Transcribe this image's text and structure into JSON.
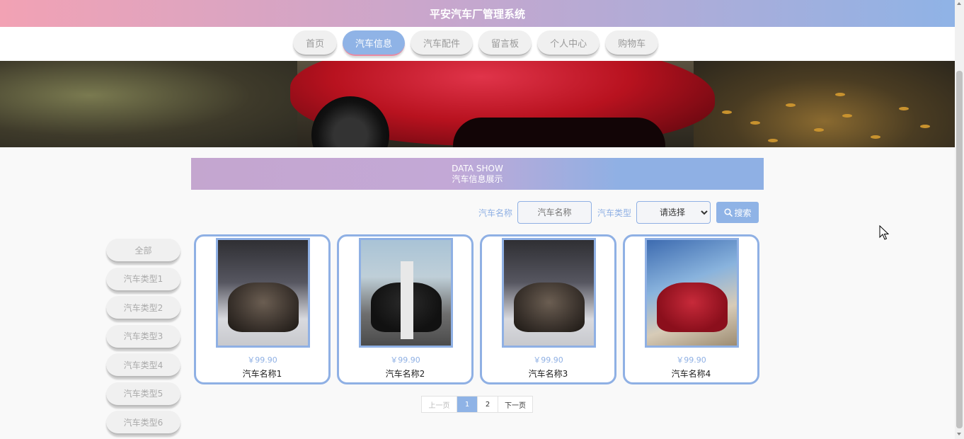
{
  "header": {
    "title": "平安汽车厂管理系统"
  },
  "nav": {
    "items": [
      {
        "label": "首页",
        "active": false
      },
      {
        "label": "汽车信息",
        "active": true
      },
      {
        "label": "汽车配件",
        "active": false
      },
      {
        "label": "留言板",
        "active": false
      },
      {
        "label": "个人中心",
        "active": false
      },
      {
        "label": "购物车",
        "active": false
      }
    ]
  },
  "section": {
    "title_en": "DATA SHOW",
    "title_cn": "汽车信息展示"
  },
  "search": {
    "name_label": "汽车名称",
    "name_placeholder": "汽车名称",
    "type_label": "汽车类型",
    "type_selected": "请选择",
    "button_label": "搜索"
  },
  "sidebar": {
    "items": [
      "全部",
      "汽车类型1",
      "汽车类型2",
      "汽车类型3",
      "汽车类型4",
      "汽车类型5",
      "汽车类型6"
    ]
  },
  "products": [
    {
      "price": "￥99.90",
      "name": "汽车名称1"
    },
    {
      "price": "￥99.90",
      "name": "汽车名称2"
    },
    {
      "price": "￥99.90",
      "name": "汽车名称3"
    },
    {
      "price": "￥99.90",
      "name": "汽车名称4"
    }
  ],
  "pagination": {
    "prev_label": "上一页",
    "pages": [
      "1",
      "2"
    ],
    "current": "1",
    "next_label": "下一页"
  },
  "colors": {
    "accent": "#8fb3e6",
    "header_gradient_start": "#f2a2b4",
    "header_gradient_end": "#8fb3e6"
  }
}
